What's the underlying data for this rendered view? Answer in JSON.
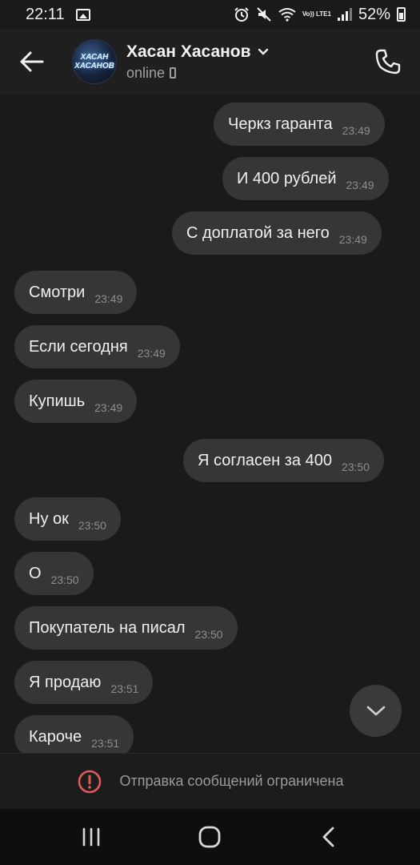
{
  "status_bar": {
    "time": "22:11",
    "volte": "Vo)) LTE1",
    "battery": "52%"
  },
  "header": {
    "contact_name": "Хасан Хасанов",
    "status": "online",
    "avatar_text": [
      "ХАСАН",
      "ХАСАНОВ"
    ]
  },
  "messages": [
    {
      "side": "out",
      "text": "Черкз гаранта",
      "time": "23:49"
    },
    {
      "side": "out",
      "text": "И 400 рублей",
      "time": "23:49"
    },
    {
      "side": "out",
      "text": "С доплатой за него",
      "time": "23:49"
    },
    {
      "side": "in",
      "text": "Смотри",
      "time": "23:49"
    },
    {
      "side": "in",
      "text": "Если сегодня",
      "time": "23:49"
    },
    {
      "side": "in",
      "text": "Купишь",
      "time": "23:49"
    },
    {
      "side": "out",
      "text": "Я согласен за 400",
      "time": "23:50"
    },
    {
      "side": "in",
      "text": "Ну ок",
      "time": "23:50"
    },
    {
      "side": "in",
      "text": "О",
      "time": "23:50"
    },
    {
      "side": "in",
      "text": "Покупатель на писал",
      "time": "23:50"
    },
    {
      "side": "in",
      "text": "Я продаю",
      "time": "23:51"
    },
    {
      "side": "in",
      "text": "Кароче",
      "time": "23:51"
    }
  ],
  "restriction": {
    "text": "Отправка сообщений ограничена",
    "icon": "alert-circle-icon",
    "icon_color": "#e05a5a"
  },
  "colors": {
    "background": "#1a1a1a",
    "bubble": "#363636"
  }
}
